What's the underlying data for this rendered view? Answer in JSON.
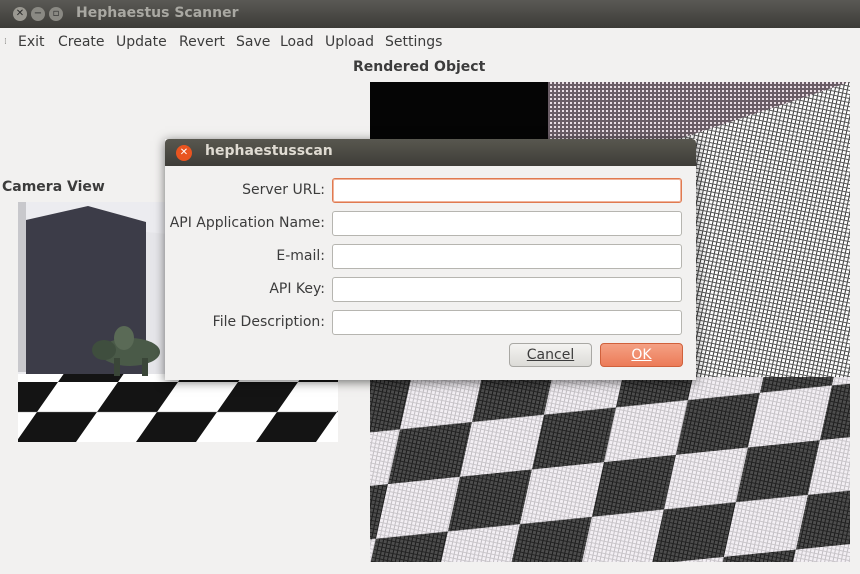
{
  "window": {
    "title": "Hephaestus Scanner"
  },
  "menu": [
    "Exit",
    "Create",
    "Update",
    "Revert",
    "Save",
    "Load",
    "Upload",
    "Settings"
  ],
  "labels": {
    "camera_view": "Camera View",
    "rendered_object": "Rendered Object"
  },
  "dialog": {
    "title": "hephaestusscan",
    "fields": [
      {
        "label": "Server URL:",
        "value": ""
      },
      {
        "label": "API Application Name:",
        "value": ""
      },
      {
        "label": "E-mail:",
        "value": ""
      },
      {
        "label": "API Key:",
        "value": ""
      },
      {
        "label": "File Description:",
        "value": ""
      }
    ],
    "cancel_label": "Cancel",
    "ok_label": "OK"
  },
  "colors": {
    "accent": "#e95420",
    "titlebar": "#3c3b37",
    "window_bg": "#f2f1f0"
  },
  "icons": {
    "close": "close-icon",
    "minimize": "minimize-icon",
    "maximize": "maximize-icon",
    "menu_grip": "grip-icon"
  }
}
